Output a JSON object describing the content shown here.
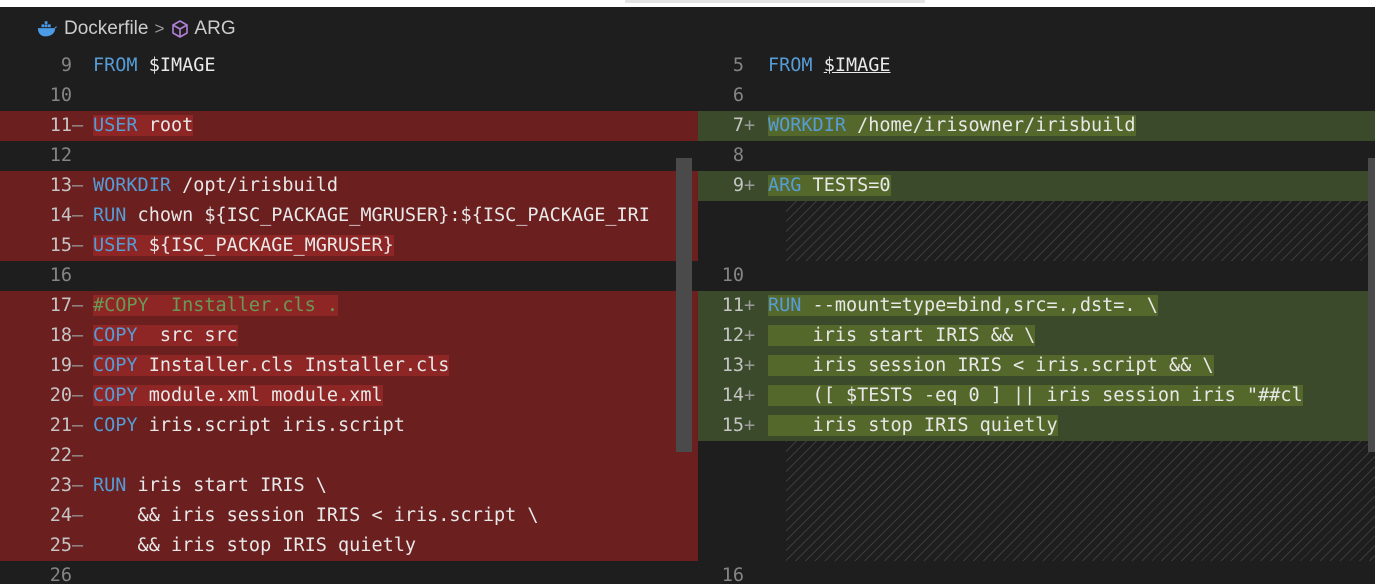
{
  "breadcrumb": {
    "file": "Dockerfile",
    "separator": ">",
    "symbol": "ARG",
    "file_icon": "docker-whale-icon",
    "symbol_icon": "cube-icon"
  },
  "colors": {
    "deleted_bg": "#6b1f1f",
    "inserted_bg": "#3a4a2a",
    "keyword": "#569cd6",
    "comment": "#6a9955",
    "string": "#ce9178"
  },
  "left": {
    "lines": [
      {
        "num": "9",
        "mk": "",
        "kw": "FROM",
        "rest": " $IMAGE"
      },
      {
        "num": "10",
        "mk": "",
        "kw": "",
        "rest": ""
      },
      {
        "num": "11",
        "mk": "—",
        "kw": "USER",
        "rest": " root"
      },
      {
        "num": "12",
        "mk": "",
        "kw": "",
        "rest": ""
      },
      {
        "num": "13",
        "mk": "—",
        "kw": "WORKDIR",
        "rest": " /opt/irisbuild"
      },
      {
        "num": "14",
        "mk": "—",
        "kw": "RUN",
        "rest": " chown ${ISC_PACKAGE_MGRUSER}:${ISC_PACKAGE_IRI"
      },
      {
        "num": "15",
        "mk": "—",
        "kw": "USER",
        "rest": " ${ISC_PACKAGE_MGRUSER}"
      },
      {
        "num": "16",
        "mk": "",
        "kw": "",
        "rest": ""
      },
      {
        "num": "17",
        "mk": "—",
        "kw": "",
        "rest": "#COPY  Installer.cls ."
      },
      {
        "num": "18",
        "mk": "—",
        "kw": "COPY",
        "rest": "  src src"
      },
      {
        "num": "19",
        "mk": "—",
        "kw": "COPY",
        "rest": " Installer.cls Installer.cls"
      },
      {
        "num": "20",
        "mk": "—",
        "kw": "COPY",
        "rest": " module.xml module.xml"
      },
      {
        "num": "21",
        "mk": "—",
        "kw": "COPY",
        "rest": " iris.script iris.script"
      },
      {
        "num": "22",
        "mk": "—",
        "kw": "",
        "rest": ""
      },
      {
        "num": "23",
        "mk": "—",
        "kw": "RUN",
        "rest": " iris start IRIS \\"
      },
      {
        "num": "24",
        "mk": "—",
        "kw": "",
        "rest": "    && iris session IRIS < iris.script \\"
      },
      {
        "num": "25",
        "mk": "—",
        "kw": "",
        "rest": "    && iris stop IRIS quietly"
      },
      {
        "num": "26",
        "mk": "",
        "kw": "",
        "rest": ""
      }
    ]
  },
  "right": {
    "lines": [
      {
        "num": "5",
        "mk": "",
        "kw": "FROM",
        "rest": "$IMAGE"
      },
      {
        "num": "6",
        "mk": "",
        "kw": "",
        "rest": ""
      },
      {
        "num": "7",
        "mk": "+",
        "kw": "WORKDIR",
        "rest": " /home/irisowner/irisbuild"
      },
      {
        "num": "8",
        "mk": "",
        "kw": "",
        "rest": ""
      },
      {
        "num": "9",
        "mk": "+",
        "kw": "ARG",
        "rest": " TESTS=0"
      },
      {
        "num": "10",
        "mk": "",
        "kw": "",
        "rest": ""
      },
      {
        "num": "11",
        "mk": "+",
        "kw": "RUN",
        "rest": " --mount=type=bind,src=.,dst=. \\"
      },
      {
        "num": "12",
        "mk": "+",
        "kw": "",
        "rest": "    iris start IRIS && \\"
      },
      {
        "num": "13",
        "mk": "+",
        "kw": "",
        "rest": "    iris session IRIS < iris.script && \\"
      },
      {
        "num": "14",
        "mk": "+",
        "kw": "",
        "rest": "    ([ $TESTS -eq 0 ] || iris session iris \"##cl"
      },
      {
        "num": "15",
        "mk": "+",
        "kw": "",
        "rest": "    iris stop IRIS quietly"
      },
      {
        "num": "16",
        "mk": "",
        "kw": "",
        "rest": ""
      }
    ]
  }
}
